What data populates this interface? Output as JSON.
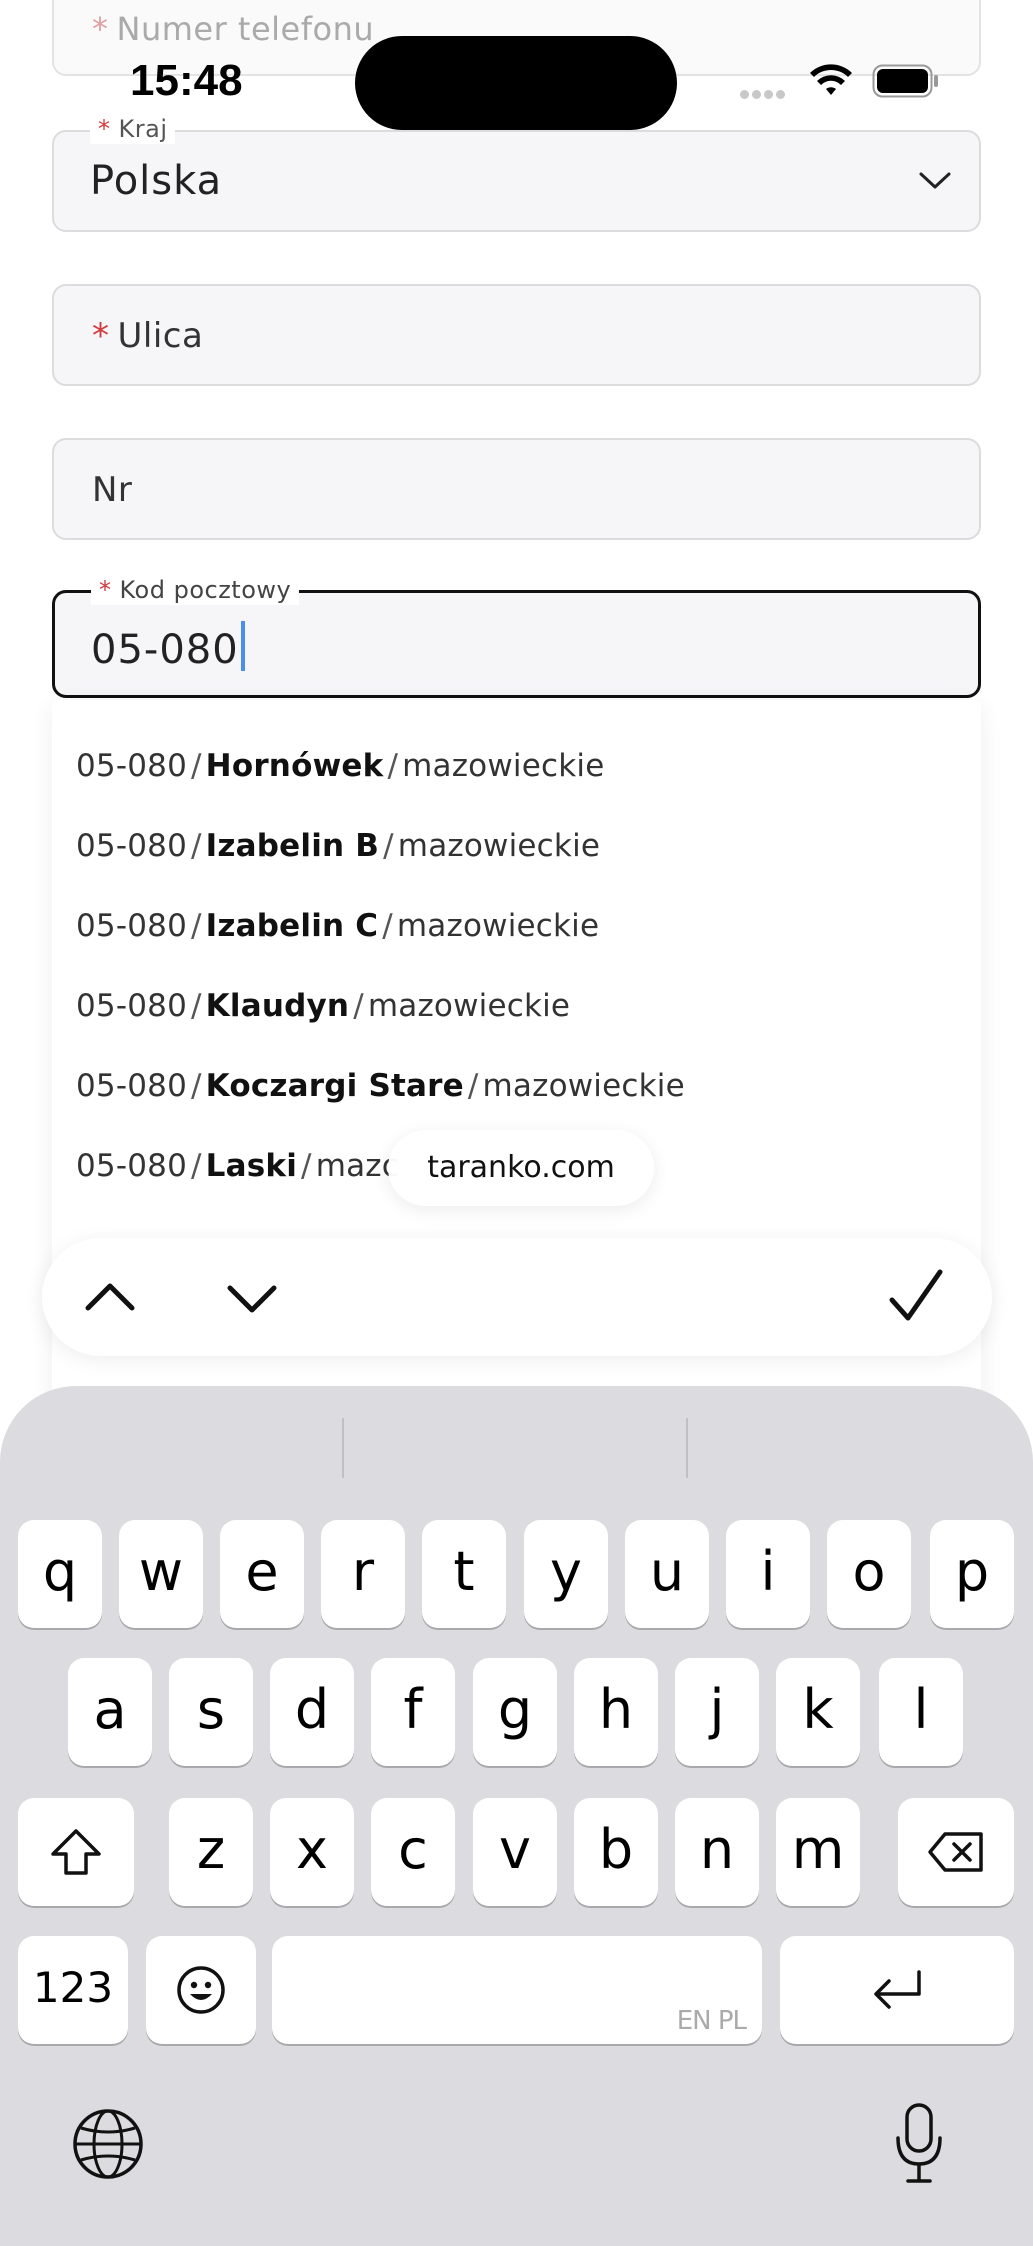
{
  "status_bar": {
    "time": "15:48"
  },
  "form": {
    "phone": {
      "placeholder": "Numer telefonu",
      "required_mark": "*"
    },
    "country": {
      "label": "Kraj",
      "required_mark": "*",
      "value": "Polska"
    },
    "street": {
      "placeholder": "Ulica",
      "required_mark": "*"
    },
    "number": {
      "placeholder": "Nr"
    },
    "postal_code": {
      "label": "Kod pocztowy",
      "required_mark": "*",
      "value": "05-080"
    }
  },
  "suggestions": {
    "separator": "/",
    "items": [
      {
        "code": "05-080",
        "city": "Hornówek",
        "region": "mazowieckie"
      },
      {
        "code": "05-080",
        "city": "Izabelin B",
        "region": "mazowieckie"
      },
      {
        "code": "05-080",
        "city": "Izabelin C",
        "region": "mazowieckie"
      },
      {
        "code": "05-080",
        "city": "Klaudyn",
        "region": "mazowieckie"
      },
      {
        "code": "05-080",
        "city": "Koczargi Stare",
        "region": "mazowieckie"
      },
      {
        "code": "05-080",
        "city": "Laski",
        "region": "mazc"
      }
    ]
  },
  "url_pill": {
    "text": "taranko.com"
  },
  "accessory_bar": {
    "prev_icon": "chevron-up-icon",
    "next_icon": "chevron-down-icon",
    "done_icon": "checkmark-icon"
  },
  "keyboard": {
    "row1": [
      "q",
      "w",
      "e",
      "r",
      "t",
      "y",
      "u",
      "i",
      "o",
      "p"
    ],
    "row2": [
      "a",
      "s",
      "d",
      "f",
      "g",
      "h",
      "j",
      "k",
      "l"
    ],
    "row3": [
      "z",
      "x",
      "c",
      "v",
      "b",
      "n",
      "m"
    ],
    "numbers_key": "123",
    "space_lang": "EN PL",
    "icons": {
      "shift": "shift-icon",
      "delete": "delete-icon",
      "emoji": "emoji-icon",
      "return": "return-icon",
      "globe": "globe-icon",
      "mic": "microphone-icon"
    }
  }
}
